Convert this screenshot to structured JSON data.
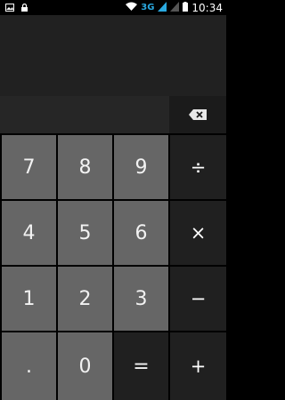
{
  "status_bar": {
    "time": "10:34",
    "network": "3G",
    "icons": [
      "image-icon",
      "lock-icon",
      "wifi-icon",
      "signal-icon",
      "signal-icon",
      "battery-icon"
    ]
  },
  "display": {
    "expression": "",
    "result": ""
  },
  "keys": {
    "row1": [
      "7",
      "8",
      "9",
      "÷"
    ],
    "row2": [
      "4",
      "5",
      "6",
      "×"
    ],
    "row3": [
      "1",
      "2",
      "3",
      "−"
    ],
    "row4": [
      ".",
      "0",
      "=",
      "+"
    ]
  },
  "colors": {
    "digit_key": "#666666",
    "op_key": "#202020",
    "display": "#212121"
  }
}
